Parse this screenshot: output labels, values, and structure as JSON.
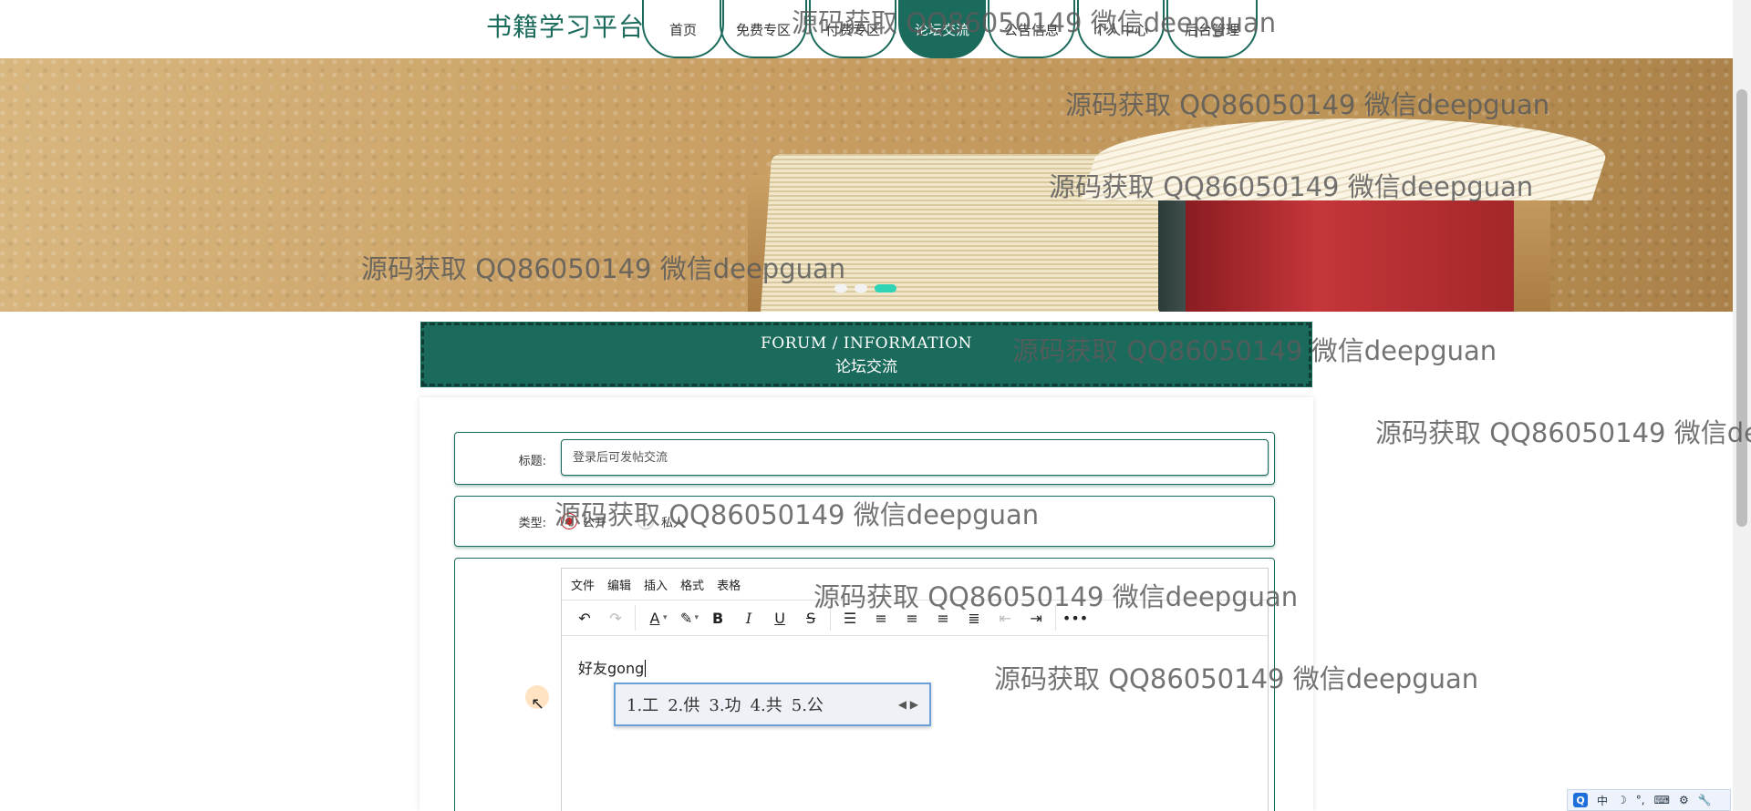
{
  "brand": "书籍学习平台",
  "nav": [
    {
      "label": "首页"
    },
    {
      "label": "免费专区"
    },
    {
      "label": "付费专区"
    },
    {
      "label": "论坛交流",
      "active": true
    },
    {
      "label": "公告信息"
    },
    {
      "label": "个人中心"
    },
    {
      "label": "后台管理"
    }
  ],
  "carousel": {
    "slide_count": 3,
    "active_index": 2
  },
  "section": {
    "title_en": "FORUM / INFORMATION",
    "title_cn": "论坛交流"
  },
  "form": {
    "title_label": "标题:",
    "title_placeholder": "登录后可发帖交流",
    "type_label": "类型:",
    "type_options": [
      {
        "label": "公开",
        "checked": true
      },
      {
        "label": "私人",
        "checked": false
      }
    ]
  },
  "editor": {
    "menu": [
      "文件",
      "编辑",
      "插入",
      "格式",
      "表格"
    ],
    "content_text": "好友",
    "composing_text": "gong"
  },
  "ime": {
    "candidates": [
      "1.工",
      "2.供",
      "3.功",
      "4.共",
      "5.公"
    ]
  },
  "tray": {
    "items": [
      "中",
      "☽",
      "°,",
      "⌨",
      "⚙",
      "🔧"
    ]
  },
  "watermark_text": "源码获取 QQ86050149 微信deepguan",
  "colors": {
    "primary": "#1b6b5c",
    "accent": "#2fd3b5",
    "radio_checked": "#c62828"
  }
}
